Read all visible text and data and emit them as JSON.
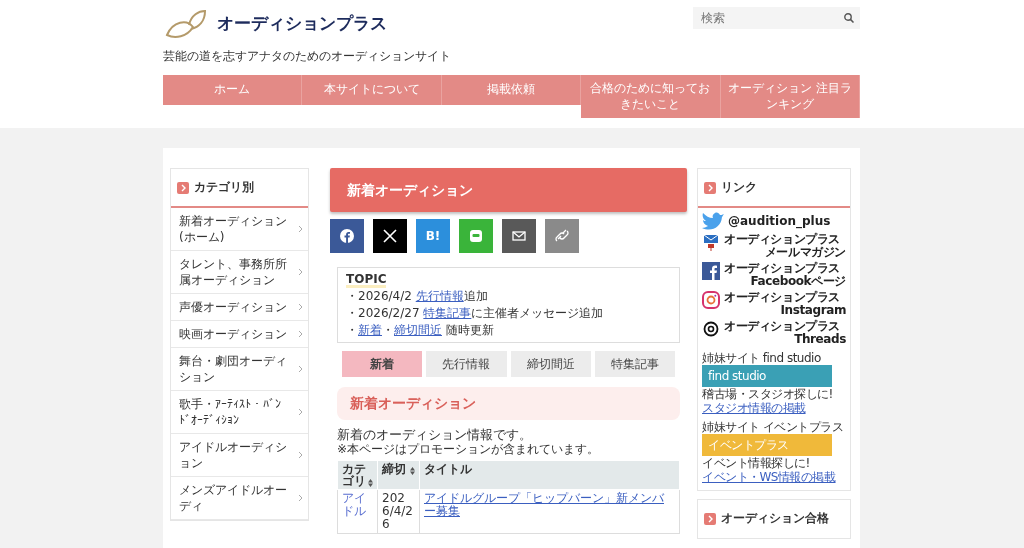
{
  "site": {
    "logo_text": "オーディションプラス",
    "tagline": "芸能の道を志すアナタのためのオーディションサイト",
    "search": {
      "placeholder": "検索"
    }
  },
  "nav": [
    {
      "label": "ホーム"
    },
    {
      "label": "本サイトについて"
    },
    {
      "label": "掲載依頼"
    },
    {
      "label": "合格のために知っておきたいこと"
    },
    {
      "label": "オーディション 注目ランキング"
    }
  ],
  "left_sidebar": {
    "title": "カテゴリ別",
    "items": [
      {
        "label": "新着オーディション(ホーム)"
      },
      {
        "label": "タレント、事務所所属オーディション"
      },
      {
        "label": "声優オーディション"
      },
      {
        "label": "映画オーディション"
      },
      {
        "label": "舞台・劇団オーディション"
      },
      {
        "label": "歌手・ｱｰﾃｨｽﾄ・ﾊﾞﾝﾄﾞｵｰﾃﾞｨｼｮﾝ"
      },
      {
        "label": "アイドルオーディション"
      },
      {
        "label": "メンズアイドルオーディ"
      }
    ]
  },
  "main": {
    "title": "新着オーディション",
    "share": [
      {
        "kind": "facebook"
      },
      {
        "kind": "x"
      },
      {
        "kind": "hatena",
        "label": "B!"
      },
      {
        "kind": "line"
      },
      {
        "kind": "mail"
      },
      {
        "kind": "link"
      }
    ],
    "topic": {
      "title": "TOPIC",
      "lines": [
        [
          {
            "kind": "text",
            "text": "・2026/4/2 "
          },
          {
            "kind": "link",
            "text": "先行情報"
          },
          {
            "kind": "text",
            "text": "追加"
          }
        ],
        [
          {
            "kind": "text",
            "text": "・2026/2/27 "
          },
          {
            "kind": "link",
            "text": "特集記事"
          },
          {
            "kind": "text",
            "text": "に主催者メッセージ追加"
          }
        ],
        [
          {
            "kind": "text",
            "text": "・"
          },
          {
            "kind": "link",
            "text": "新着"
          },
          {
            "kind": "text",
            "text": "・"
          },
          {
            "kind": "link",
            "text": "締切間近"
          },
          {
            "kind": "text",
            "text": " 随時更新"
          }
        ]
      ]
    },
    "tabs": [
      {
        "label": "新着",
        "selected": true
      },
      {
        "label": "先行情報",
        "selected": false
      },
      {
        "label": "締切間近",
        "selected": false
      },
      {
        "label": "特集記事",
        "selected": false
      }
    ],
    "section_heading": "新着オーディション",
    "intro": "新着のオーディション情報です。",
    "note": "※本ページはプロモーションが含まれています。",
    "table": {
      "columns": [
        {
          "label": "カテゴリ",
          "kind": "sortable"
        },
        {
          "label": "締切",
          "kind": "sortable"
        },
        {
          "label": "タイトル",
          "kind": "plain"
        }
      ],
      "rows": [
        {
          "category": "アイドル",
          "deadline": "2026/4/26",
          "title": "アイドルグループ「ヒップバーン」新メンバー募集"
        }
      ]
    }
  },
  "right_sidebar": {
    "title": "リンク",
    "twitter": "@audition_plus",
    "links": [
      {
        "kind": "mail",
        "line1": "オーディションプラス",
        "line2": "メールマガジン"
      },
      {
        "kind": "facebook",
        "line1": "オーディションプラス",
        "line2": "Facebookページ"
      },
      {
        "kind": "instagram",
        "line1": "オーディションプラス",
        "line2": "Instagram"
      },
      {
        "kind": "threads",
        "line1": "オーディションプラス",
        "line2": "Threads"
      }
    ],
    "sisters": [
      {
        "kind": "studio",
        "label": "姉妹サイト find studio",
        "banner_title": "find studio",
        "caption": "稽古場・スタジオ探しに!",
        "link": "スタジオ情報の掲載"
      },
      {
        "kind": "event",
        "label": "姉妹サイト イベントプラス",
        "banner_title": "イベントプラス",
        "caption": "イベント情報探しに!",
        "link": "イベント・WS情報の掲載"
      }
    ],
    "next_title": "オーディション合格"
  }
}
